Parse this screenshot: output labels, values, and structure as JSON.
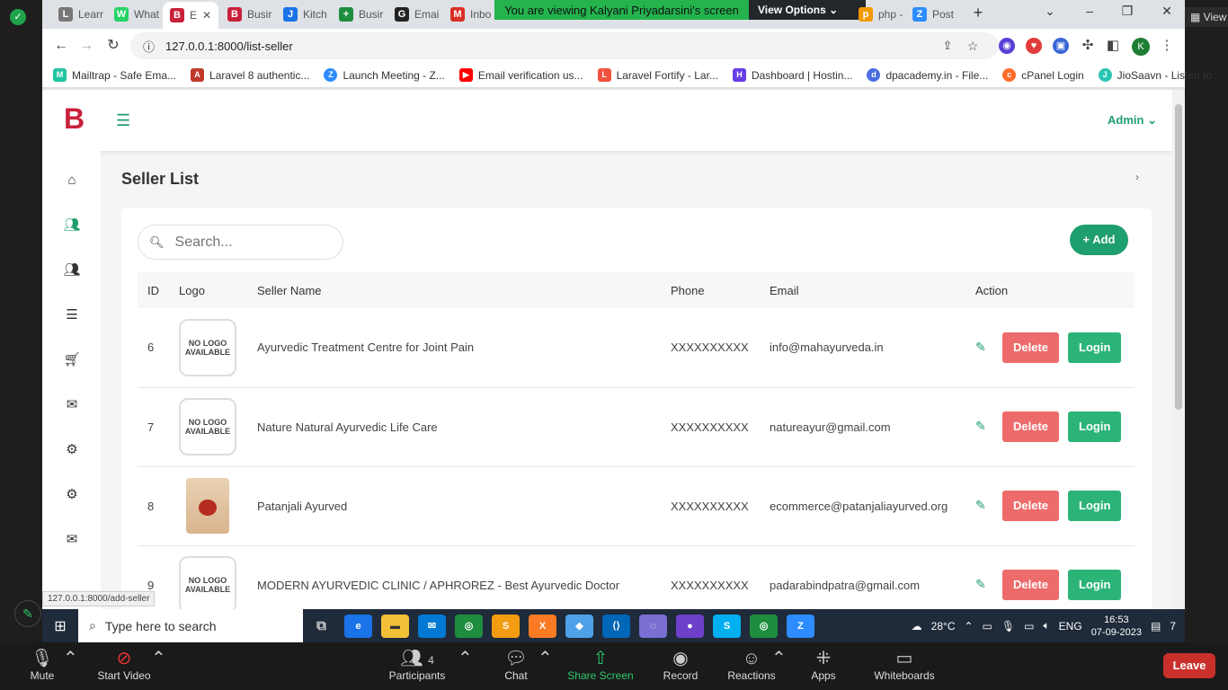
{
  "share_banner": {
    "text": "You are viewing Kalyani Priyadarsini's screen",
    "options_label": "View Options"
  },
  "zoom_view_label": "View",
  "tabs": [
    {
      "label": "Learr",
      "icon": "L",
      "color": "#666"
    },
    {
      "label": "What",
      "icon": "W",
      "color": "#25d366"
    },
    {
      "label": "E",
      "icon": "B",
      "color": "#c8213a"
    },
    {
      "label": "Busir",
      "icon": "B",
      "color": "#c8213a"
    },
    {
      "label": "Kitch",
      "icon": "J",
      "color": "#1a73e8"
    },
    {
      "label": "Busir",
      "icon": "+",
      "color": "#1e8e3e"
    },
    {
      "label": "Emai",
      "icon": "G",
      "color": "#222"
    },
    {
      "label": "Inbo",
      "icon": "M",
      "color": "#d93025"
    },
    {
      "label": "php -",
      "icon": "p",
      "color": "#f29900"
    },
    {
      "label": "Post",
      "icon": "Z",
      "color": "#2d8cff"
    }
  ],
  "address": {
    "url": "127.0.0.1:8000/list-seller"
  },
  "bookmarks": [
    {
      "label": "Mailtrap - Safe Ema...",
      "icon": "M",
      "color": "#22c5a0"
    },
    {
      "label": "Laravel 8 authentic...",
      "icon": "A",
      "color": "#c0392b"
    },
    {
      "label": "Launch Meeting - Z...",
      "icon": "Z",
      "color": "#2d8cff"
    },
    {
      "label": "Email verification us...",
      "icon": "▶",
      "color": "#ff0000"
    },
    {
      "label": "Laravel Fortify - Lar...",
      "icon": "L",
      "color": "#f05340"
    },
    {
      "label": "Dashboard | Hostin...",
      "icon": "H",
      "color": "#673de6"
    },
    {
      "label": "dpacademy.in - File...",
      "icon": "d",
      "color": "#4a6ee0"
    },
    {
      "label": "cPanel Login",
      "icon": "c",
      "color": "#ff6c2c"
    },
    {
      "label": "JioSaavn - Listen to...",
      "icon": "J",
      "color": "#2bc5b4"
    }
  ],
  "app": {
    "brand": "B",
    "admin_label": "Admin",
    "page_title": "Seller List",
    "search_placeholder": "Search...",
    "add_label": "+ Add",
    "columns": [
      "ID",
      "Logo",
      "Seller Name",
      "Phone",
      "Email",
      "Action"
    ],
    "rows": [
      {
        "id": "6",
        "logo": "NO LOGO AVAILABLE",
        "name": "Ayurvedic Treatment Centre for Joint Pain",
        "phone": "XXXXXXXXXX",
        "email": "info@mahayurveda.in"
      },
      {
        "id": "7",
        "logo": "NO LOGO AVAILABLE",
        "name": "Nature Natural Ayurvedic Life Care",
        "phone": "XXXXXXXXXX",
        "email": "natureayur@gmail.com"
      },
      {
        "id": "8",
        "logo": "",
        "name": "Patanjali Ayurved",
        "phone": "XXXXXXXXXX",
        "email": "ecommerce@patanjaliayurved.org"
      },
      {
        "id": "9",
        "logo": "NO LOGO AVAILABLE",
        "name": "MODERN AYURVEDIC CLINIC / APHROREZ - Best Ayurvedic Doctor",
        "phone": "XXXXXXXXXX",
        "email": "padarabindpatra@gmail.com"
      }
    ],
    "delete_label": "Delete",
    "login_label": "Login",
    "status_url": "127.0.0.1:8000/add-seller"
  },
  "taskbar": {
    "search_placeholder": "Type here to search",
    "weather": "28°C",
    "lang": "ENG",
    "time": "16:53",
    "date": "07-09-2023",
    "notification_count": "7"
  },
  "zoom": {
    "mute": "Mute",
    "start_video": "Start Video",
    "participants": "Participants",
    "participants_count": "4",
    "chat": "Chat",
    "share_screen": "Share Screen",
    "record": "Record",
    "reactions": "Reactions",
    "apps": "Apps",
    "whiteboards": "Whiteboards",
    "leave": "Leave"
  }
}
